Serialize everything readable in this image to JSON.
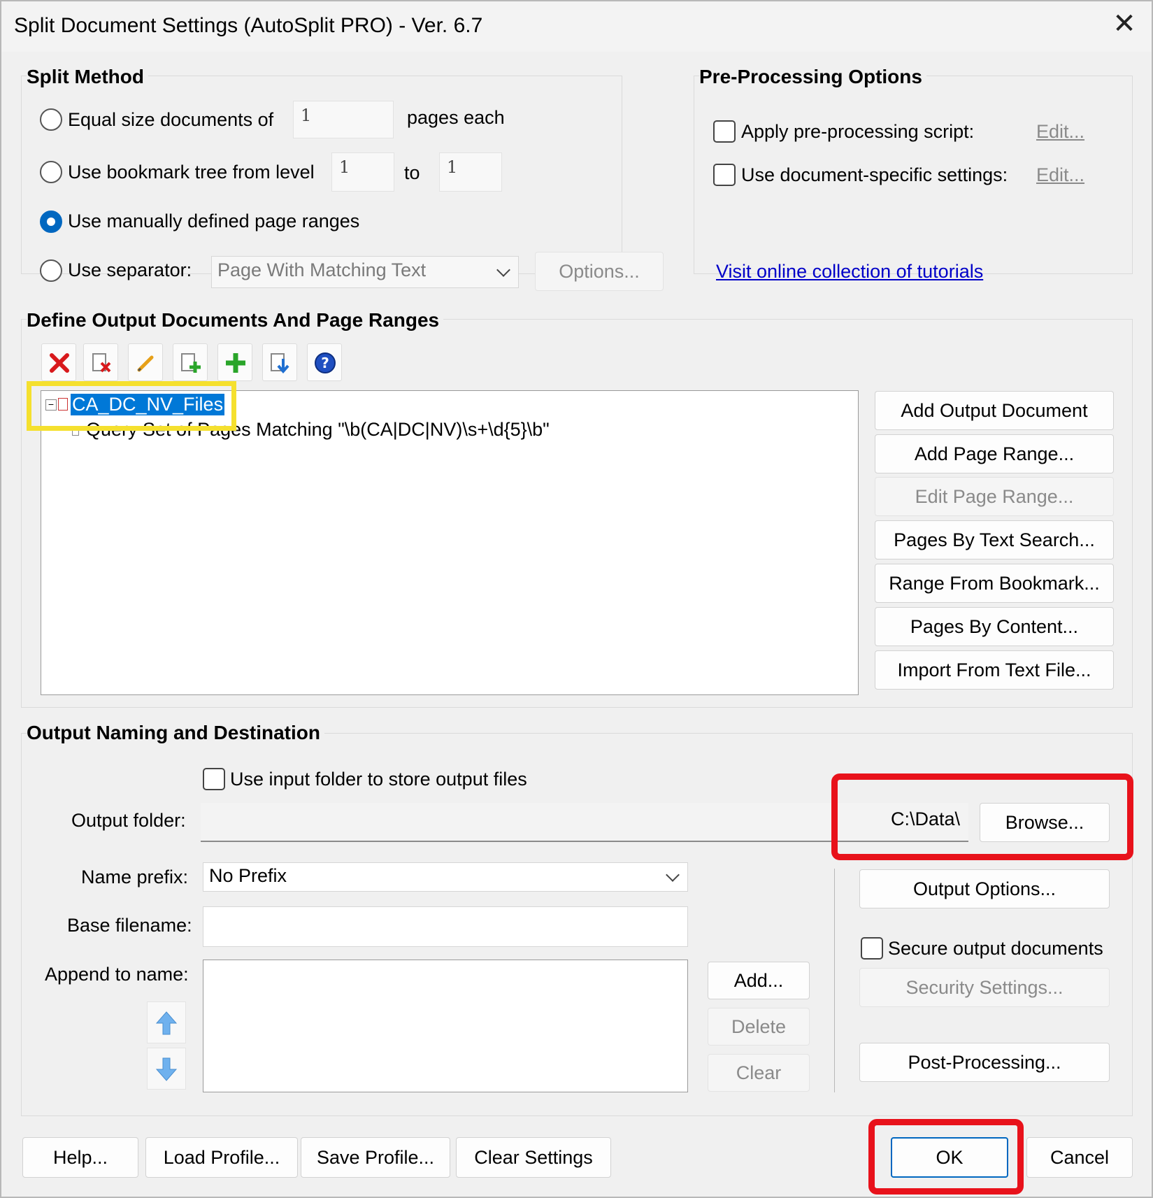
{
  "window": {
    "title": "Split Document Settings (AutoSplit PRO) - Ver. 6.7"
  },
  "split_method": {
    "title": "Split Method",
    "equal_size_label": "Equal size documents of",
    "equal_size_value": "1",
    "pages_each_label": "pages each",
    "bookmark_label": "Use bookmark tree from level",
    "bookmark_from": "1",
    "to_label": "to",
    "bookmark_to": "1",
    "manual_label": "Use manually defined page ranges",
    "separator_label": "Use separator:",
    "separator_value": "Page With Matching Text",
    "options_button": "Options...",
    "selected": "manual"
  },
  "preprocessing": {
    "title": "Pre-Processing Options",
    "apply_script_label": "Apply pre-processing script:",
    "doc_specific_label": "Use document-specific settings:",
    "edit_link": "Edit...",
    "tutorials_link": "Visit online collection of tutorials"
  },
  "define_output": {
    "title": "Define Output Documents And Page Ranges",
    "toolbar_icons": [
      "delete-icon",
      "delete-document-icon",
      "edit-icon",
      "add-document-icon",
      "add-icon",
      "import-icon",
      "help-icon"
    ],
    "tree": {
      "root_label": "CA_DC_NV_Files",
      "child_label": "Query Set of Pages Matching \"\\b(CA|DC|NV)\\s+\\d{5}\\b\""
    },
    "buttons": {
      "add_output": "Add Output Document",
      "add_range": "Add Page Range...",
      "edit_range": "Edit Page Range...",
      "by_text": "Pages By Text Search...",
      "from_bookmark": "Range From Bookmark...",
      "by_content": "Pages By Content...",
      "import_text": "Import From Text File..."
    }
  },
  "output_naming": {
    "title": "Output Naming and Destination",
    "use_input_folder_label": "Use input folder to store output files",
    "output_folder_label": "Output folder:",
    "output_folder_value": "C:\\Data\\",
    "browse_button": "Browse...",
    "name_prefix_label": "Name prefix:",
    "name_prefix_value": "No Prefix",
    "base_filename_label": "Base filename:",
    "base_filename_value": "",
    "append_label": "Append to name:",
    "add_button": "Add...",
    "delete_button": "Delete",
    "clear_button": "Clear",
    "output_options_button": "Output Options...",
    "secure_label": "Secure output documents",
    "security_settings_button": "Security Settings...",
    "post_processing_button": "Post-Processing..."
  },
  "footer": {
    "help": "Help...",
    "load_profile": "Load Profile...",
    "save_profile": "Save Profile...",
    "clear_settings": "Clear Settings",
    "ok": "OK",
    "cancel": "Cancel"
  },
  "colors": {
    "accent": "#0067c0",
    "highlight_red": "#e8121b",
    "highlight_yellow": "#f5e02e",
    "selection": "#0078d7",
    "link": "#0000c8"
  }
}
